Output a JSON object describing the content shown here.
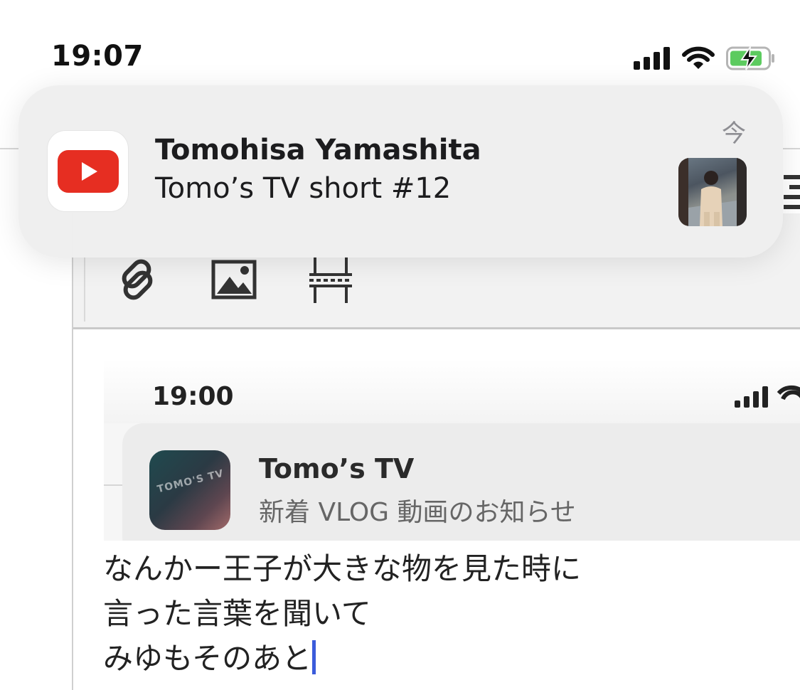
{
  "status_bar": {
    "time": "19:07"
  },
  "notification": {
    "app": "youtube",
    "title": "Tomohisa Yamashita",
    "body": "Tomo’s TV short #12",
    "time": "今",
    "thumbnail": "video-thumbnail"
  },
  "toolbar": {
    "items": [
      "link-icon",
      "image-icon",
      "table-icon"
    ]
  },
  "embedded_screenshot": {
    "time": "19:00",
    "app_name": "Tomo’s TV",
    "message": "新着 VLOG 動画のお知らせ",
    "icon_text": "TOMO'S TV"
  },
  "editor": {
    "lines": [
      "なんかー王子が大きな物を見た時に",
      "言った言葉を聞いて",
      "みゆもそのあと"
    ]
  },
  "colors": {
    "youtube_red": "#e62e22",
    "caret": "#3b5bdb",
    "battery_green": "#5ccb5f"
  }
}
